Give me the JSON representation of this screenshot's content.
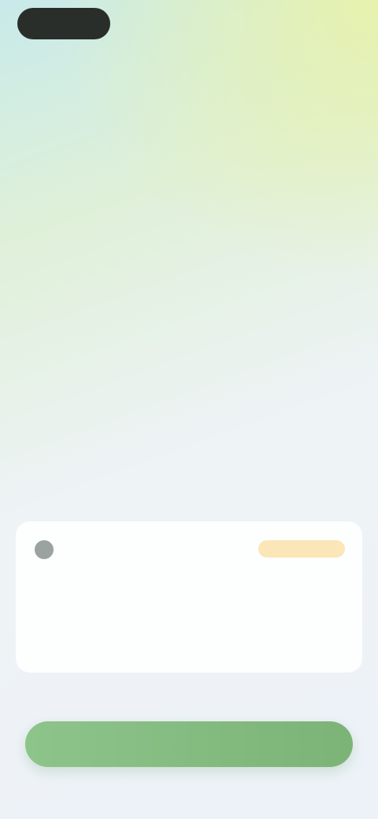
{
  "header": {
    "logo_label": "",
    "nav_link_1": "",
    "nav_link_2": "",
    "subnav": ""
  },
  "hero": {
    "headline_regular": "",
    "headline_bold": ""
  },
  "card": {
    "author": "",
    "badge": "",
    "title": "",
    "body": ""
  },
  "footer": {
    "note": "",
    "cta_label": ""
  },
  "colors": {
    "accent": "#7cb477",
    "badge_bg": "#fbe6b8",
    "dark": "#2a2e2b"
  }
}
